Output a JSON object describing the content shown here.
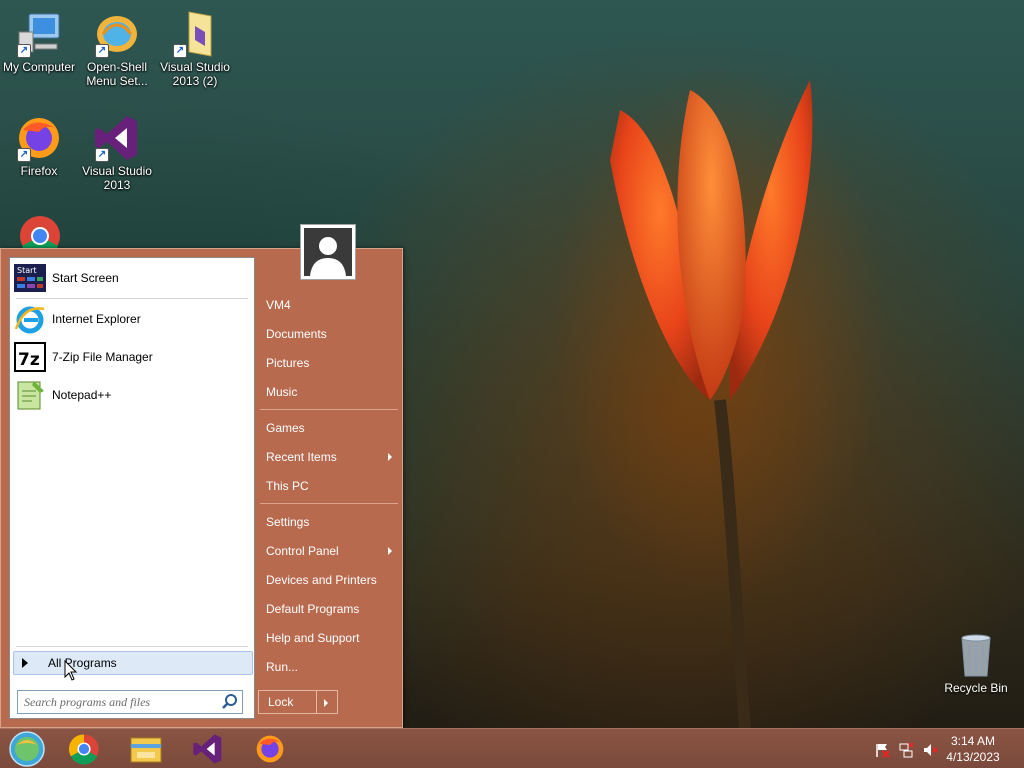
{
  "desktop": {
    "icons": [
      {
        "label": "My Computer"
      },
      {
        "label": "Open-Shell Menu Set..."
      },
      {
        "label": "Visual Studio 2013 (2)"
      },
      {
        "label": "Firefox"
      },
      {
        "label": "Visual Studio 2013"
      }
    ],
    "recycle_bin": "Recycle Bin"
  },
  "start_menu": {
    "programs": [
      {
        "label": "Start Screen",
        "icon": "start-screen-icon",
        "icon_text": "Start"
      },
      {
        "label": "Internet Explorer",
        "icon": "internet-explorer-icon"
      },
      {
        "label": "7-Zip File Manager",
        "icon": "seven-zip-icon",
        "icon_text": "7z"
      },
      {
        "label": "Notepad++",
        "icon": "notepad-plus-plus-icon"
      }
    ],
    "all_programs": "All Programs",
    "search_placeholder": "Search programs and files",
    "right_items": [
      {
        "label": "VM4"
      },
      {
        "label": "Documents"
      },
      {
        "label": "Pictures"
      },
      {
        "label": "Music"
      },
      {
        "label": "Games"
      },
      {
        "label": "Recent Items",
        "submenu": true
      },
      {
        "label": "This PC"
      },
      {
        "label": "Settings"
      },
      {
        "label": "Control Panel",
        "submenu": true
      },
      {
        "label": "Devices and Printers"
      },
      {
        "label": "Default Programs"
      },
      {
        "label": "Help and Support"
      },
      {
        "label": "Run..."
      }
    ],
    "lock_label": "Lock"
  },
  "taskbar": {
    "time": "3:14 AM",
    "date": "4/13/2023",
    "colors": {
      "taskbar": "#7b4a3c",
      "menu": "#b86a4f"
    }
  }
}
